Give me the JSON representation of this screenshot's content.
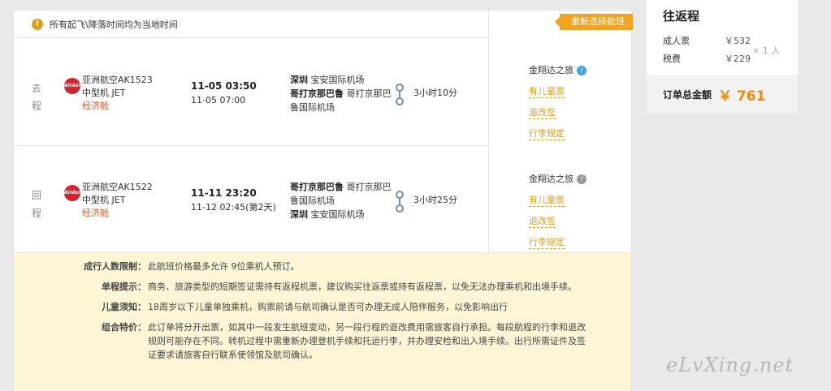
{
  "notice": {
    "icon": "info-icon",
    "text": "所有起飞\\降落时间均为当地时间"
  },
  "reselect_label": "重新选择航班",
  "outbound": {
    "direction": "去程",
    "airline_logo": "AirAsia",
    "flight": "亚洲航空AK1523",
    "aircraft": "中型机 JET",
    "cabin": "经济舱",
    "dep_time": "11-05 03:50",
    "arr_time": "11-05 07:00",
    "dep_city": "深圳",
    "dep_airport": "宝安国际机场",
    "arr_city": "哥打京那巴鲁",
    "arr_airport": "哥打京那巴鲁国际机场",
    "duration": "3小时10分",
    "member_program": "金翔达之旅",
    "member_badge": "?",
    "links": [
      "有儿童票",
      "退改签",
      "行李规定"
    ]
  },
  "inbound": {
    "direction": "回程",
    "airline_logo": "AirAsia",
    "flight": "亚洲航空AK1522",
    "aircraft": "中型机 JET",
    "cabin": "经济舱",
    "dep_time": "11-11 23:20",
    "arr_time": "11-12 02:45(第2天)",
    "dep_city": "哥打京那巴鲁",
    "dep_airport": "哥打京那巴鲁国际机场",
    "arr_city": "深圳",
    "arr_airport": "宝安国际机场",
    "duration": "3小时25分",
    "member_program": "金翔达之旅",
    "member_badge": "?",
    "links": [
      "有儿童票",
      "退改签",
      "行李规定"
    ]
  },
  "rules": [
    {
      "label": "成行人数限制：",
      "text": "此航班价格最多允许 9位乘机人预订。"
    },
    {
      "label": "单程提示：",
      "text": "商务、旅游类型的短期签证需持有返程机票，建议购买往返票或持有返程票，以免无法办理乘机和出境手续。"
    },
    {
      "label": "儿童须知：",
      "text": "18周岁以下儿童单独乘机，购票前请与航司确认是否可办理无成人陪伴服务，以免影响出行"
    },
    {
      "label": "组合特价：",
      "text": "此订单将分开出票，如其中一段发生航班变动，另一段行程的退改费用需旅客自行承担。每段航程的行李和退改规则可能存在不同。转机过程中需重新办理登机手续和托运行李，并办理安检和出入境手续。出行所需证件及签证要求请旅客自行联系使领馆及航司确认。"
    }
  ],
  "summary": {
    "title": "往返程",
    "adult_label": "成人票",
    "adult_price": "￥532",
    "tax_label": "税费",
    "tax_price": "￥229",
    "multiplier": "× 1 人",
    "total_label": "订单总金额",
    "total_amount": "￥ 761"
  },
  "watermark": "eLvXing.net"
}
